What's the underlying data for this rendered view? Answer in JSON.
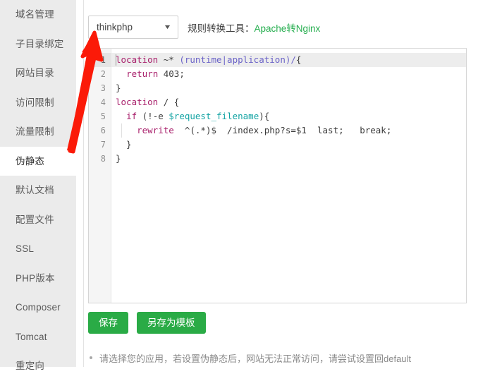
{
  "sidebar": {
    "items": [
      {
        "label": "域名管理",
        "active": false
      },
      {
        "label": "子目录绑定",
        "active": false
      },
      {
        "label": "网站目录",
        "active": false
      },
      {
        "label": "访问限制",
        "active": false
      },
      {
        "label": "流量限制",
        "active": false
      },
      {
        "label": "伪静态",
        "active": true
      },
      {
        "label": "默认文档",
        "active": false
      },
      {
        "label": "配置文件",
        "active": false
      },
      {
        "label": "SSL",
        "active": false
      },
      {
        "label": "PHP版本",
        "active": false
      },
      {
        "label": "Composer",
        "active": false
      },
      {
        "label": "Tomcat",
        "active": false
      },
      {
        "label": "重定向",
        "active": false
      }
    ]
  },
  "toolbar": {
    "select_value": "thinkphp",
    "select_caret": "▼",
    "tool_label": "规则转换工具：",
    "tool_link": "Apache转Nginx",
    "link_color": "#26ae4f"
  },
  "editor": {
    "line_numbers": [
      "1",
      "2",
      "3",
      "4",
      "5",
      "6",
      "7",
      "8"
    ],
    "active_line": 1,
    "lines": [
      {
        "n": 1,
        "tokens": [
          {
            "t": "location",
            "c": "kw"
          },
          {
            "t": " ~* ",
            "c": "def"
          },
          {
            "t": "(runtime|application)/",
            "c": "str"
          },
          {
            "t": "{",
            "c": "def"
          }
        ]
      },
      {
        "n": 2,
        "tokens": [
          {
            "t": "  ",
            "c": "def"
          },
          {
            "t": "return",
            "c": "kw"
          },
          {
            "t": " 403;",
            "c": "def"
          }
        ]
      },
      {
        "n": 3,
        "tokens": [
          {
            "t": "}",
            "c": "def"
          }
        ]
      },
      {
        "n": 4,
        "tokens": [
          {
            "t": "location",
            "c": "kw"
          },
          {
            "t": " / {",
            "c": "def"
          }
        ]
      },
      {
        "n": 5,
        "tokens": [
          {
            "t": "  ",
            "c": "def"
          },
          {
            "t": "if",
            "c": "kw"
          },
          {
            "t": " (!-e ",
            "c": "def"
          },
          {
            "t": "$request_filename",
            "c": "var"
          },
          {
            "t": "){",
            "c": "def"
          }
        ]
      },
      {
        "n": 6,
        "tokens": [
          {
            "t": "    ",
            "c": "def"
          },
          {
            "t": "rewrite",
            "c": "kw"
          },
          {
            "t": "  ^(.*)$  /index.php?s=$1  last;   break;",
            "c": "def"
          }
        ]
      },
      {
        "n": 7,
        "tokens": [
          {
            "t": "  }",
            "c": "def"
          }
        ]
      },
      {
        "n": 8,
        "tokens": [
          {
            "t": "}",
            "c": "def"
          }
        ]
      }
    ],
    "plain_text": "location ~* (runtime|application)/{\n  return 403;\n}\nlocation / {\n  if (!-e $request_filename){\n    rewrite  ^(.*)$  /index.php?s=$1  last;   break;\n  }\n}"
  },
  "buttons": {
    "save": "保存",
    "save_as_template": "另存为模板",
    "color": "#2aab46"
  },
  "hint": {
    "text": "请选择您的应用，若设置伪静态后，网站无法正常访问，请尝试设置回default"
  },
  "annotation": {
    "arrow_color": "#fb1a08",
    "name": "red-arrow-pointing-to-app-select"
  }
}
